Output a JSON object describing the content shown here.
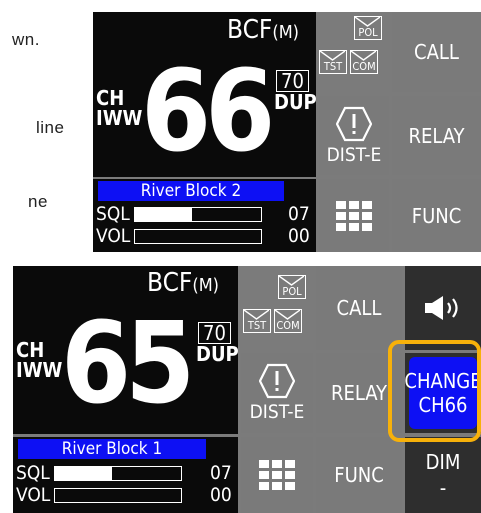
{
  "doc_fragments": [
    "wn.",
    "line",
    "ne"
  ],
  "top_panel": {
    "station": "BCF",
    "mode": "(M)",
    "ch_label": "CH",
    "region": "IWW",
    "channel": "66",
    "subchannel": "70",
    "dup": "DUP",
    "block": "River Block 2",
    "sql_label": "SQL",
    "sql_value": "07",
    "sql_level": 0.45,
    "vol_label": "VOL",
    "vol_value": "00",
    "vol_level": 0.0,
    "env_pol": "POL",
    "env_tst": "TST",
    "env_com": "COM",
    "call_label": "CALL",
    "dist_label": "DIST-E",
    "relay_label": "RELAY",
    "func_label": "FUNC"
  },
  "bottom_panel": {
    "station": "BCF",
    "mode": "(M)",
    "ch_label": "CH",
    "region": "IWW",
    "channel": "65",
    "subchannel": "70",
    "dup": "DUP",
    "block": "River Block 1",
    "sql_label": "SQL",
    "sql_value": "07",
    "sql_level": 0.45,
    "vol_label": "VOL",
    "vol_value": "00",
    "vol_level": 0.0,
    "env_pol": "POL",
    "env_tst": "TST",
    "env_com": "COM",
    "call_label": "CALL",
    "dist_label": "DIST-E",
    "relay_label": "RELAY",
    "func_label": "FUNC",
    "change_line1": "CHANGE",
    "change_line2": "CH66",
    "dim_label": "DIM",
    "dim_value": "-"
  },
  "colors": {
    "panel_grey": "#7a7a7a",
    "lcd_black": "#0a0a0a",
    "accent_blue": "#0d10f4",
    "highlight_orange": "#f7b10a"
  }
}
